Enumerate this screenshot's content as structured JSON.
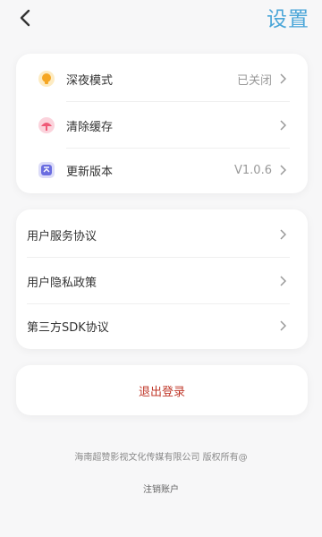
{
  "header": {
    "title": "设置",
    "back_icon": "back-arrow-icon"
  },
  "group1": {
    "items": [
      {
        "label": "深夜模式",
        "value": "已关闭",
        "icon": "lightbulb-icon",
        "icon_color": "#f5a623"
      },
      {
        "label": "清除缓存",
        "value": "",
        "icon": "broom-icon",
        "icon_color": "#ef5a78"
      },
      {
        "label": "更新版本",
        "value": "V1.0.6",
        "icon": "update-icon",
        "icon_color": "#6a6de0"
      }
    ]
  },
  "group2": {
    "items": [
      {
        "label": "用户服务协议"
      },
      {
        "label": "用户隐私政策"
      },
      {
        "label": "第三方SDK协议"
      }
    ]
  },
  "logout": {
    "label": "退出登录",
    "color": "#c0392b"
  },
  "footer": {
    "copyright": "海南超赞影视文化传媒有限公司 版权所有@",
    "cancel_account": "注销账户"
  },
  "colors": {
    "accent": "#4aa6d8",
    "background": "#f7f7f8"
  }
}
